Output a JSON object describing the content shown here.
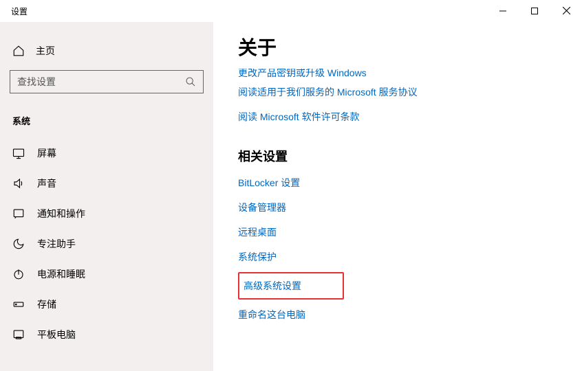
{
  "titlebar": {
    "title": "设置"
  },
  "sidebar": {
    "home": "主页",
    "search_placeholder": "查找设置",
    "category": "系统",
    "items": [
      {
        "label": "屏幕"
      },
      {
        "label": "声音"
      },
      {
        "label": "通知和操作"
      },
      {
        "label": "专注助手"
      },
      {
        "label": "电源和睡眠"
      },
      {
        "label": "存储"
      },
      {
        "label": "平板电脑"
      }
    ]
  },
  "content": {
    "title": "关于",
    "clipped_link": "更改产品密钥或升级 Windows",
    "links_top": [
      "阅读适用于我们服务的 Microsoft 服务协议",
      "阅读 Microsoft 软件许可条款"
    ],
    "related_title": "相关设置",
    "related": [
      "BitLocker 设置",
      "设备管理器",
      "远程桌面",
      "系统保护"
    ],
    "highlighted": "高级系统设置",
    "after_highlight": [
      "重命名这台电脑"
    ]
  }
}
